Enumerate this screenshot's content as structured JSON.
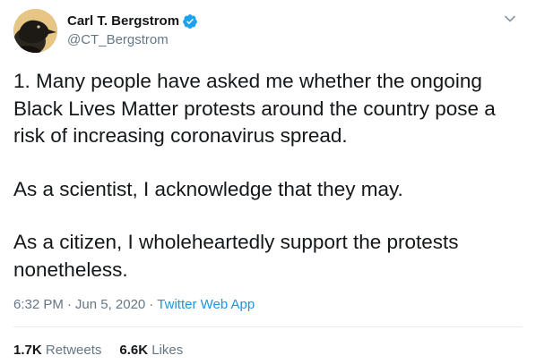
{
  "author": {
    "display_name": "Carl T. Bergstrom",
    "handle": "@CT_Bergstrom",
    "verified": true
  },
  "tweet": {
    "paragraphs": [
      "1. Many people have asked me whether the ongoing Black Lives Matter protests around the country pose a risk of increasing coronavirus spread.",
      "As a scientist, I acknowledge that they may.",
      "As a citizen, I wholeheartedly support the protests nonetheless."
    ],
    "time": "6:32 PM",
    "date": "Jun 5, 2020",
    "source": "Twitter Web App",
    "separator": "·"
  },
  "stats": {
    "retweets_count": "1.7K",
    "retweets_label": "Retweets",
    "likes_count": "6.6K",
    "likes_label": "Likes"
  },
  "icons": {
    "avatar": "raven-avatar-icon",
    "verified": "verified-badge-icon",
    "menu": "chevron-down-icon"
  },
  "colors": {
    "text_primary": "#14171a",
    "text_secondary": "#657786",
    "link": "#1b95e0",
    "verified": "#1da1f2",
    "avatar_bg": "#e3c07d"
  }
}
